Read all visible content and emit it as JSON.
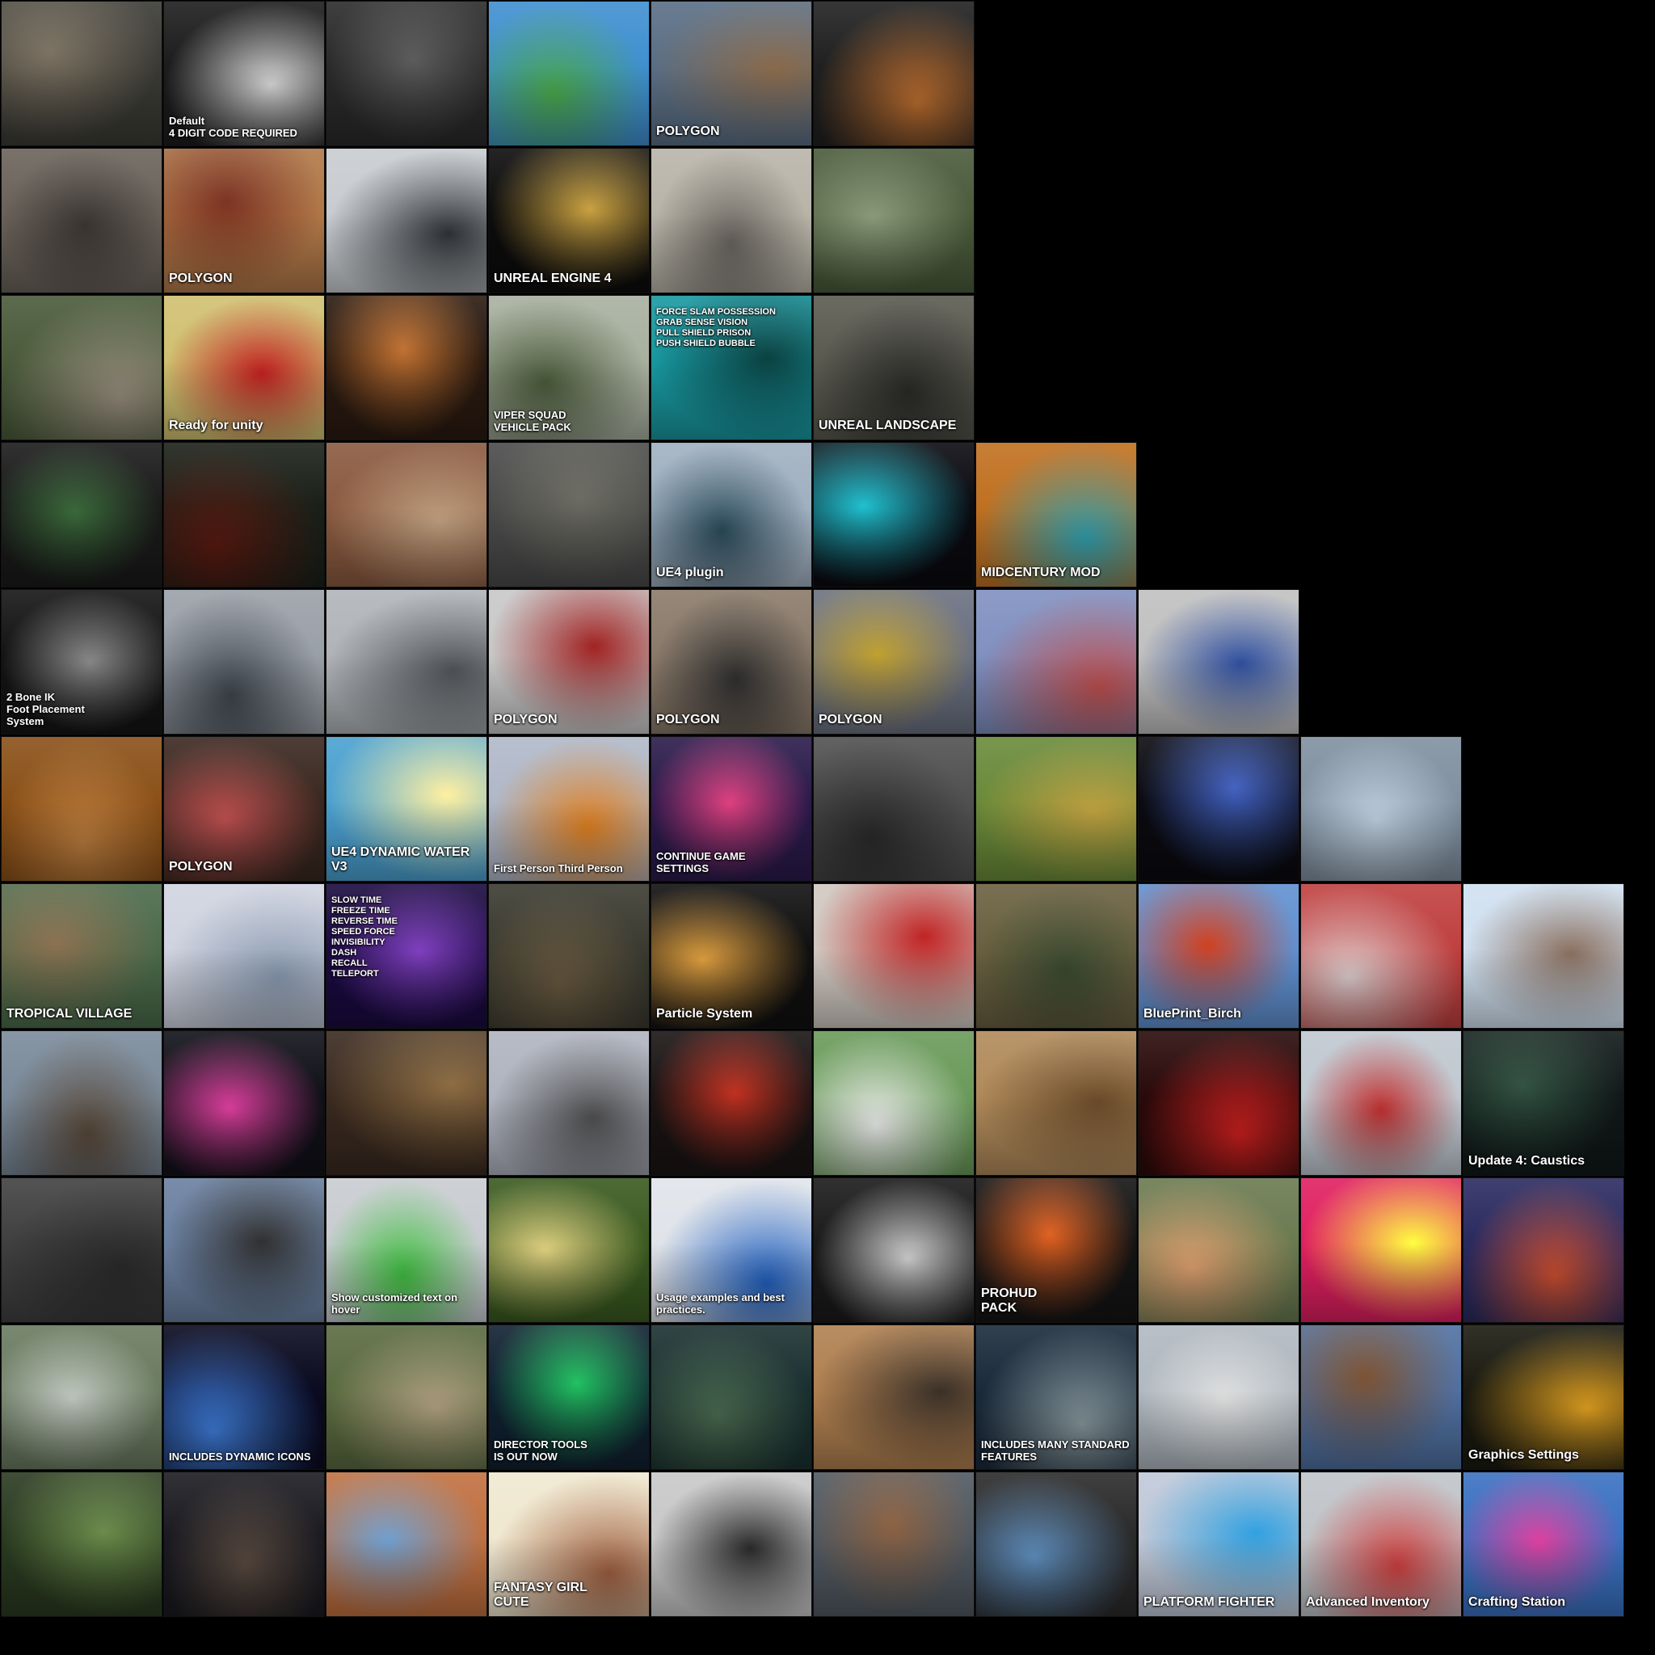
{
  "tiles": [
    {
      "bg": "#3a3a34",
      "accent": "#7a7060",
      "text": ""
    },
    {
      "bg": "#1c1c1c",
      "accent": "#d8d8d8",
      "text": "Default\n4 DIGIT CODE REQUIRED"
    },
    {
      "bg": "#2a2a2a",
      "accent": "#5a5a5a",
      "text": ""
    },
    {
      "bg": "#3f8fd0",
      "accent": "#4aa84a",
      "text": ""
    },
    {
      "bg": "#5a6e84",
      "accent": "#8a6a4a",
      "text": "POLYGON"
    },
    {
      "bg": "#202020",
      "accent": "#c07030",
      "text": ""
    },
    {
      "bg": "#6a625a",
      "accent": "#3a3632",
      "text": ""
    },
    {
      "bg": "#b07848",
      "accent": "#7a3020",
      "text": "POLYGON"
    },
    {
      "bg": "#c8ccd0",
      "accent": "#303438",
      "text": ""
    },
    {
      "bg": "#0c0c0c",
      "accent": "#c8a040",
      "text": "UNREAL ENGINE 4"
    },
    {
      "bg": "#b8b4a8",
      "accent": "#6a6660",
      "text": ""
    },
    {
      "bg": "#4a5a3a",
      "accent": "#8a9a7a",
      "text": ""
    },
    {
      "bg": "#4a5a3a",
      "accent": "#9a9080",
      "text": ""
    },
    {
      "bg": "#d0c070",
      "accent": "#c02020",
      "text": "Ready for unity"
    },
    {
      "bg": "#2a1a10",
      "accent": "#c07030",
      "text": ""
    },
    {
      "bg": "#a8b0a0",
      "accent": "#4a5a3a",
      "text": "VIPER SQUAD\nVEHICLE PACK"
    },
    {
      "bg": "#1898a0",
      "accent": "#0a4040",
      "text": "FORCE SLAM POSSESSION\nGRAB SENSE VISION\nPULL SHIELD PRISON\nPUSH SHIELD BUBBLE"
    },
    {
      "bg": "#5a5a50",
      "accent": "#2a2a28",
      "text": "UNREAL LANDSCAPE"
    },
    {
      "bg": "#1a1a1a",
      "accent": "#3a6a3a",
      "text": ""
    },
    {
      "bg": "#1a2018",
      "accent": "#5a1a10",
      "text": ""
    },
    {
      "bg": "#8a5a40",
      "accent": "#c0a080",
      "text": ""
    },
    {
      "bg": "#4a4a4a",
      "accent": "#6a6a60",
      "text": ""
    },
    {
      "bg": "#a0b0c0",
      "accent": "#2a4a5a",
      "text": "UE4 plugin"
    },
    {
      "bg": "#0a0a10",
      "accent": "#20c0d0",
      "text": ""
    },
    {
      "bg": "#c07020",
      "accent": "#30a0b0",
      "text": "MIDCENTURY MOD"
    },
    {
      "bg": "#141414",
      "accent": "#8a8a8a",
      "text": "2 Bone IK\nFoot Placement\nSystem"
    },
    {
      "bg": "#9aa0a8",
      "accent": "#404850",
      "text": ""
    },
    {
      "bg": "#b0b4b8",
      "accent": "#505458",
      "text": ""
    },
    {
      "bg": "#c8c8c8",
      "accent": "#a02020",
      "text": "POLYGON"
    },
    {
      "bg": "#8a7a6a",
      "accent": "#303030",
      "text": "POLYGON"
    },
    {
      "bg": "#6a7080",
      "accent": "#c0a030",
      "text": "POLYGON"
    },
    {
      "bg": "#8090c0",
      "accent": "#c05050",
      "text": ""
    },
    {
      "bg": "#c0c0c0",
      "accent": "#3050a0",
      "text": ""
    },
    {
      "bg": "#8a5018",
      "accent": "#c08040",
      "text": ""
    },
    {
      "bg": "#3a2820",
      "accent": "#c05050",
      "text": "POLYGON"
    },
    {
      "bg": "#4aa0d0",
      "accent": "#fff0a0",
      "text": "UE4 DYNAMIC WATER\nV3"
    },
    {
      "bg": "#b0b8c8",
      "accent": "#e08020",
      "text": "First Person  Third Person"
    },
    {
      "bg": "#2a1a4a",
      "accent": "#e04080",
      "text": "CONTINUE GAME\nSETTINGS"
    },
    {
      "bg": "#505050",
      "accent": "#2a2a2a",
      "text": ""
    },
    {
      "bg": "#6a8a3a",
      "accent": "#c0a040",
      "text": ""
    },
    {
      "bg": "#0a0a10",
      "accent": "#4060c0",
      "text": ""
    },
    {
      "bg": "#8090a0",
      "accent": "#c0d0e0",
      "text": ""
    },
    {
      "bg": "#4a6a4a",
      "accent": "#8a7050",
      "text": "TROPICAL VILLAGE"
    },
    {
      "bg": "#d0d4e0",
      "accent": "#8a9ab0",
      "text": ""
    },
    {
      "bg": "#1a0a40",
      "accent": "#8040c0",
      "text": "SLOW TIME\nFREEZE TIME\nREVERSE TIME\nSPEED FORCE\nINVISIBILITY\nDASH\nRECALL\nTELEPORT"
    },
    {
      "bg": "#3a3a30",
      "accent": "#6a5a40",
      "text": ""
    },
    {
      "bg": "#101010",
      "accent": "#e0a040",
      "text": "Particle System"
    },
    {
      "bg": "#d0c8c0",
      "accent": "#c02020",
      "text": ""
    },
    {
      "bg": "#6a6040",
      "accent": "#3a4a30",
      "text": ""
    },
    {
      "bg": "#6090d0",
      "accent": "#d04020",
      "text": "BluePrint_Birch"
    },
    {
      "bg": "#c04040",
      "accent": "#e0d0d0",
      "text": ""
    },
    {
      "bg": "#d0e0f0",
      "accent": "#8a7060",
      "text": ""
    },
    {
      "bg": "#7a8a9a",
      "accent": "#5a4a3a",
      "text": ""
    },
    {
      "bg": "#101018",
      "accent": "#e040a0",
      "text": ""
    },
    {
      "bg": "#3a2a20",
      "accent": "#8a6a40",
      "text": ""
    },
    {
      "bg": "#b0b4c0",
      "accent": "#505050",
      "text": ""
    },
    {
      "bg": "#1a1414",
      "accent": "#c03020",
      "text": ""
    },
    {
      "bg": "#6a9a5a",
      "accent": "#f0f0f0",
      "text": ""
    },
    {
      "bg": "#b08a5a",
      "accent": "#6a4a2a",
      "text": ""
    },
    {
      "bg": "#2a0a0a",
      "accent": "#d02020",
      "text": ""
    },
    {
      "bg": "#c0c8d0",
      "accent": "#c03030",
      "text": ""
    },
    {
      "bg": "#101818",
      "accent": "#305040",
      "text": "Update 4: Caustics"
    },
    {
      "bg": "#404040",
      "accent": "#2a2a2a",
      "text": ""
    },
    {
      "bg": "#6a80a0",
      "accent": "#303030",
      "text": ""
    },
    {
      "bg": "#c8ccd0",
      "accent": "#40c040",
      "text": "Show customized text on hover"
    },
    {
      "bg": "#3a5a20",
      "accent": "#e0d080",
      "text": ""
    },
    {
      "bg": "#e0e4ea",
      "accent": "#2060c0",
      "text": "Usage examples and best practices."
    },
    {
      "bg": "#1a1a1a",
      "accent": "#d0d0d0",
      "text": ""
    },
    {
      "bg": "#141414",
      "accent": "#e06020",
      "text": "PROHUD\nPACK"
    },
    {
      "bg": "#6a7a50",
      "accent": "#e0a070",
      "text": ""
    },
    {
      "bg": "#e02060",
      "accent": "#ffff40",
      "text": ""
    },
    {
      "bg": "#2a2a60",
      "accent": "#d05030",
      "text": ""
    },
    {
      "bg": "#6a7a60",
      "accent": "#c0c8c0",
      "text": ""
    },
    {
      "bg": "#0a0a20",
      "accent": "#4080e0",
      "text": "INCLUDES DYNAMIC ICONS"
    },
    {
      "bg": "#5a6a40",
      "accent": "#b0a080",
      "text": ""
    },
    {
      "bg": "#102030",
      "accent": "#20c060",
      "text": "DIRECTOR TOOLS\nIS OUT NOW"
    },
    {
      "bg": "#1a3030",
      "accent": "#4a6a50",
      "text": ""
    },
    {
      "bg": "#b08050",
      "accent": "#3a3028",
      "text": ""
    },
    {
      "bg": "#1a2a3a",
      "accent": "#8a9aa0",
      "text": "INCLUDES MANY STANDARD FEATURES"
    },
    {
      "bg": "#b0b8c0",
      "accent": "#e0e0e0",
      "text": ""
    },
    {
      "bg": "#5070a0",
      "accent": "#7a5030",
      "text": ""
    },
    {
      "bg": "#1a1a10",
      "accent": "#e0a020",
      "text": "Graphics Settings"
    },
    {
      "bg": "#2a3a20",
      "accent": "#6a8a4a",
      "text": ""
    },
    {
      "bg": "#1a1a20",
      "accent": "#5a4a40",
      "text": ""
    },
    {
      "bg": "#c07040",
      "accent": "#70a0d0",
      "text": ""
    },
    {
      "bg": "#f0e8d0",
      "accent": "#a06040",
      "text": "FANTASY GIRL\nCUTE"
    },
    {
      "bg": "#c8c8c8",
      "accent": "#2a2a2a",
      "text": ""
    },
    {
      "bg": "#505860",
      "accent": "#8a6040",
      "text": ""
    },
    {
      "bg": "#2a2a2a",
      "accent": "#6090c0",
      "text": ""
    },
    {
      "bg": "#c0c8d8",
      "accent": "#30a0e0",
      "text": "PLATFORM FIGHTER"
    },
    {
      "bg": "#c0c4c8",
      "accent": "#d04040",
      "text": "Advanced Inventory"
    },
    {
      "bg": "#3a70c0",
      "accent": "#e040a0",
      "text": "Crafting Station"
    }
  ],
  "rows": [
    6,
    6,
    6,
    7,
    8,
    9,
    10,
    10,
    10,
    10,
    10
  ]
}
